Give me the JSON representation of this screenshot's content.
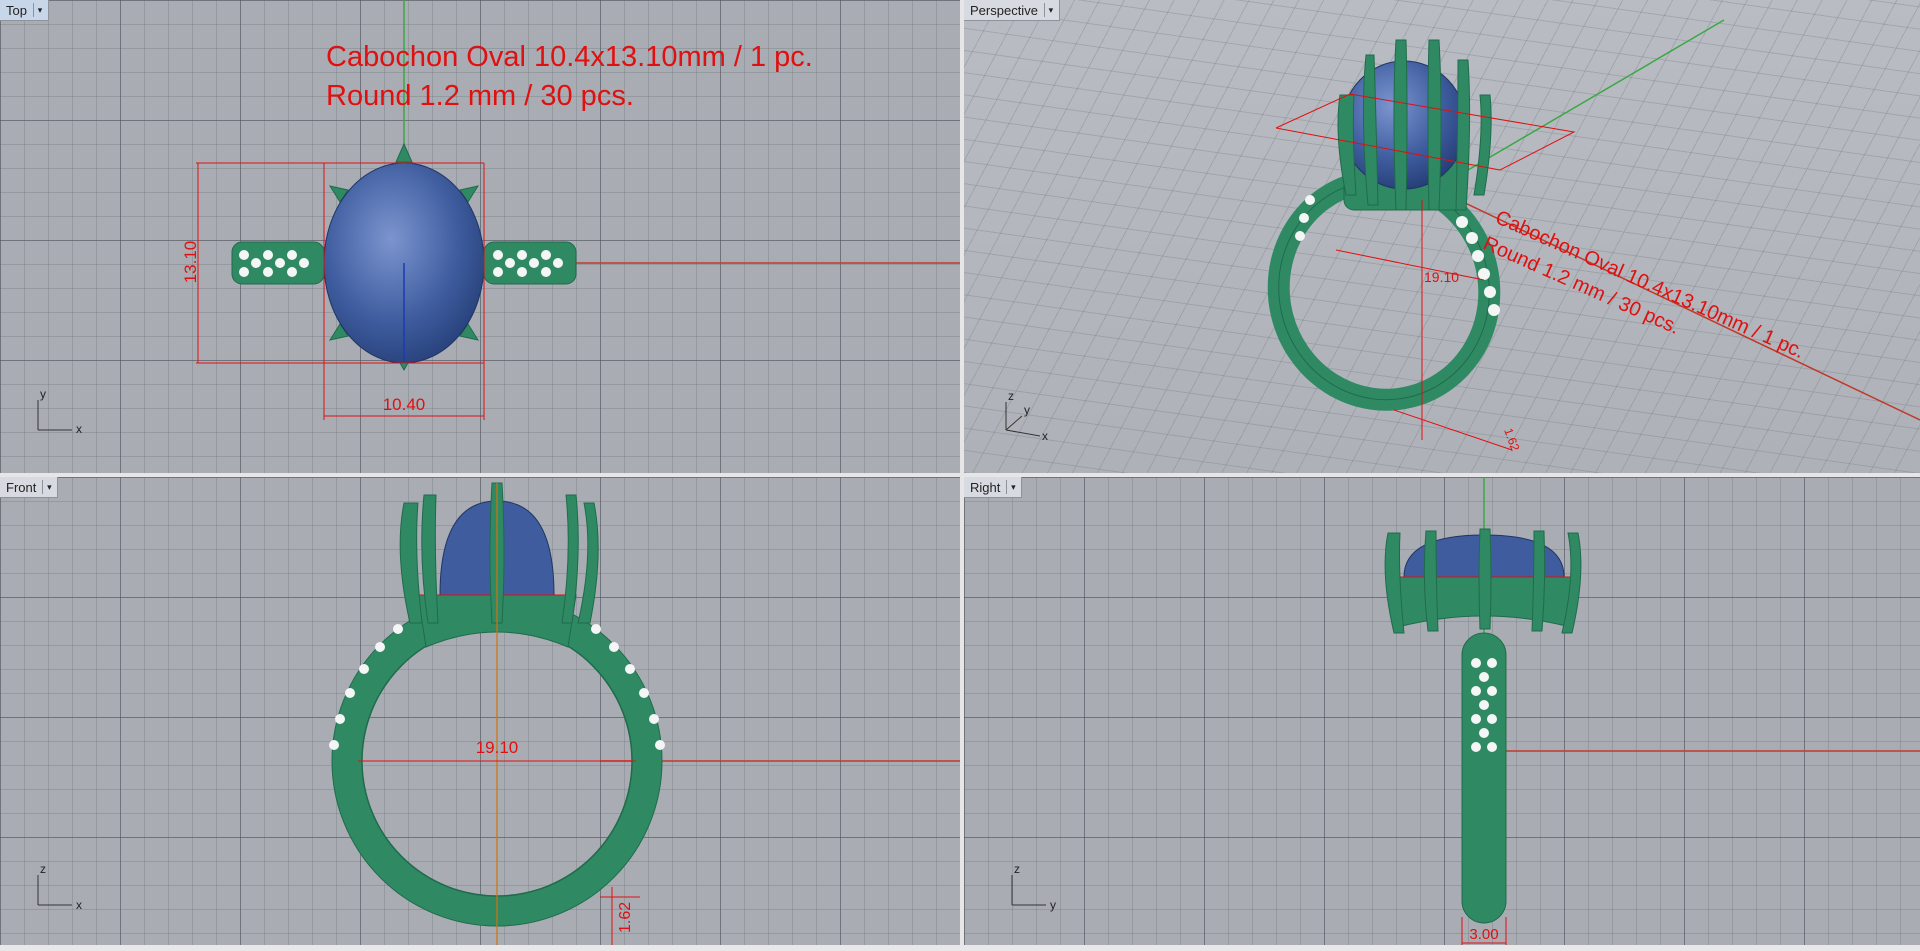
{
  "viewports": {
    "top": {
      "label": "Top"
    },
    "perspective": {
      "label": "Perspective"
    },
    "front": {
      "label": "Front"
    },
    "right": {
      "label": "Right"
    }
  },
  "annotation": {
    "line1": "Cabochon Oval 10.4x13.10mm / 1 pc.",
    "line2": "Round 1.2 mm / 30 pcs."
  },
  "dimensions": {
    "top_height": "13.10",
    "top_width": "10.40",
    "persp_diameter": "19.10",
    "persp_small": "1.62",
    "front_diameter": "19.10",
    "front_band": "1.62",
    "right_width": "3.00"
  },
  "axes": {
    "top": [
      "y",
      "x"
    ],
    "perspective": [
      "z",
      "y",
      "x"
    ],
    "front": [
      "z",
      "x"
    ],
    "right": [
      "z",
      "y"
    ]
  },
  "colors": {
    "metal": "#2f8a64",
    "metal_dark": "#1f6b4b",
    "stone": "#3e5c9e",
    "dimension": "#e01010",
    "axis_x": "#c0392b",
    "axis_y": "#3aa845"
  },
  "icons": {
    "viewport_menu": "caret-down-icon"
  }
}
